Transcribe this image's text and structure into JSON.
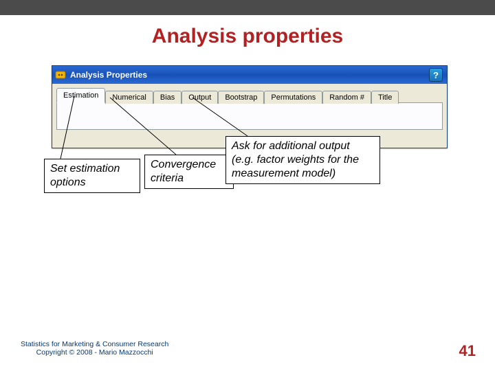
{
  "slide": {
    "title": "Analysis properties"
  },
  "window": {
    "title": "Analysis Properties",
    "help_label": "?",
    "tabs": [
      {
        "label": "Estimation",
        "active": true
      },
      {
        "label": "Numerical",
        "active": false
      },
      {
        "label": "Bias",
        "active": false
      },
      {
        "label": "Output",
        "active": false
      },
      {
        "label": "Bootstrap",
        "active": false
      },
      {
        "label": "Permutations",
        "active": false
      },
      {
        "label": "Random #",
        "active": false
      },
      {
        "label": "Title",
        "active": false
      }
    ]
  },
  "callouts": {
    "estimation": "Set estimation options",
    "convergence": "Convergence criteria",
    "output": "Ask for additional output (e.g. factor weights for the measurement model)"
  },
  "footer": {
    "line1": "Statistics for Marketing & Consumer Research",
    "line2": "Copyright © 2008 - Mario Mazzocchi"
  },
  "page_number": "41"
}
